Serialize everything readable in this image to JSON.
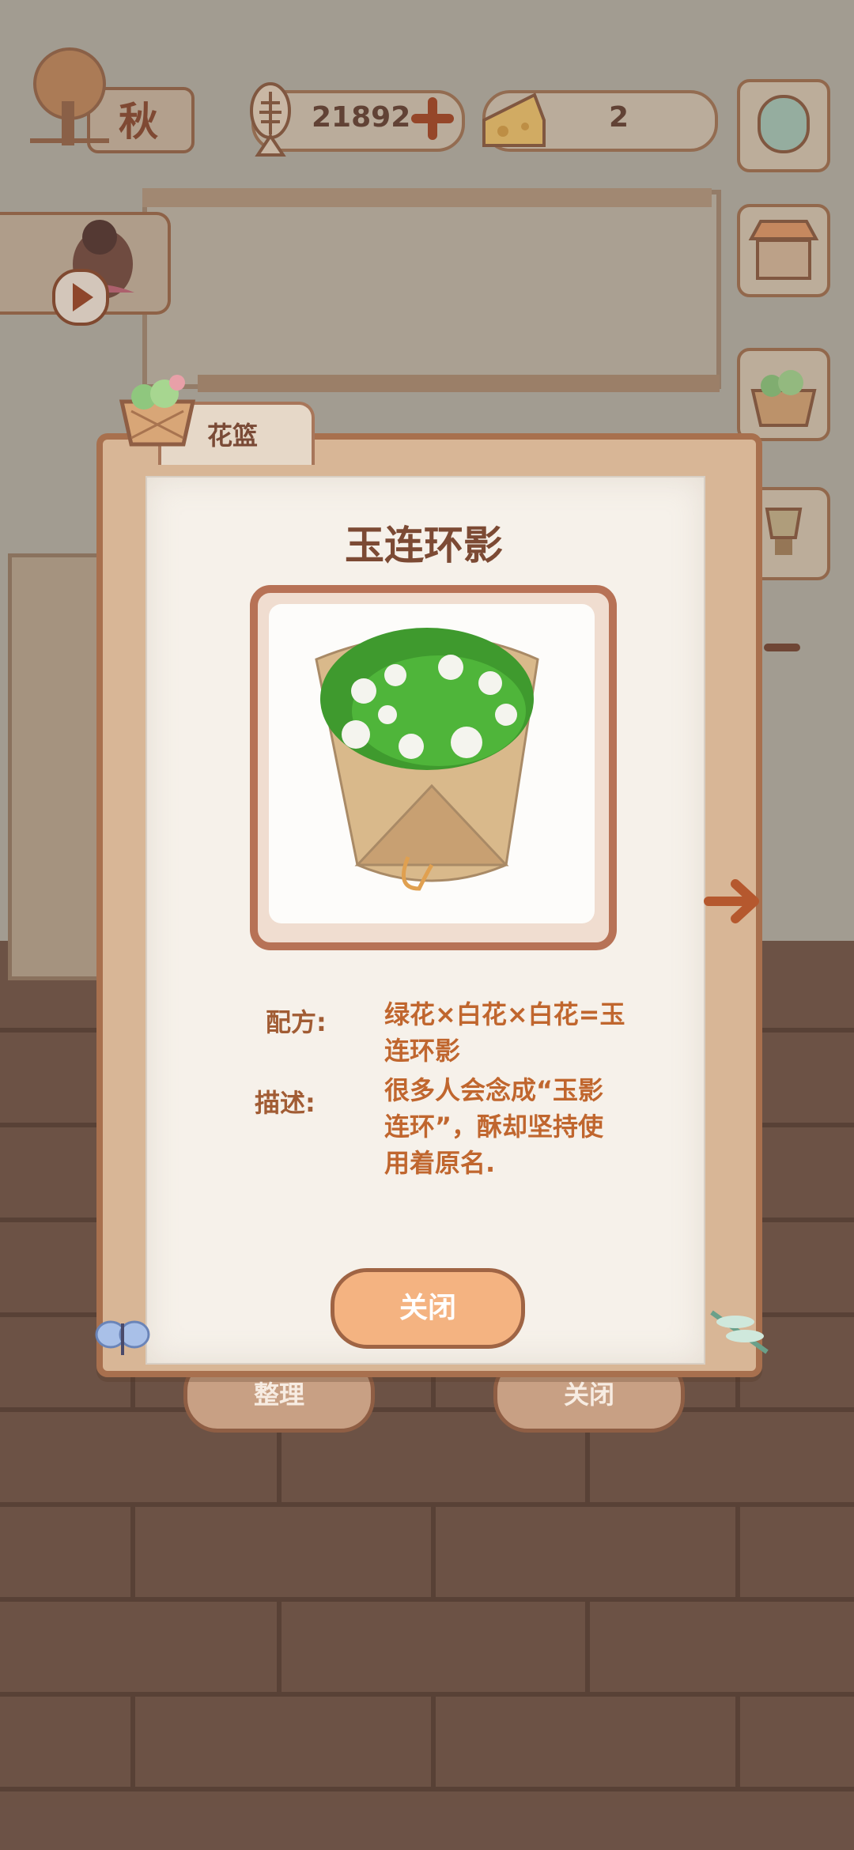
{
  "hud": {
    "season": "秋",
    "coins": "21892",
    "cheese": "2",
    "coin_icon": "fish-bone-icon",
    "cheese_icon": "cheese-icon"
  },
  "modal": {
    "tab_label": "花篮",
    "title": "玉连环影",
    "recipe_label": "配方:",
    "recipe_value": "绿花×白花×白花=玉连环影",
    "desc_label": "描述:",
    "desc_value": "很多人会念成“玉影连环”，酥却坚持使用着原名.",
    "close_label": "关闭"
  },
  "bottom": {
    "organize_label": "整理",
    "close_label": "关闭"
  },
  "colors": {
    "frame": "#a8704e",
    "paper": "#f6f1ea",
    "title": "#7c4a34",
    "accent": "#c0662e",
    "button": "#f4b381"
  }
}
